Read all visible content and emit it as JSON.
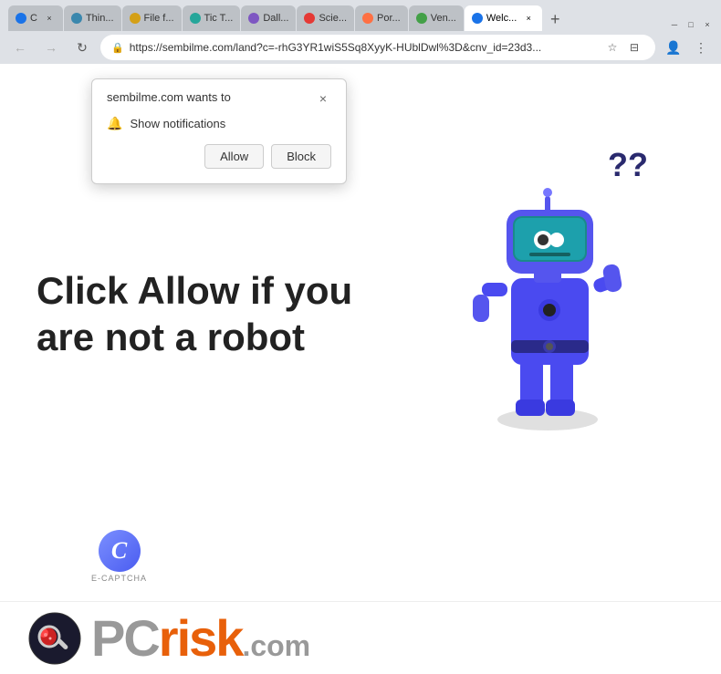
{
  "browser": {
    "tabs": [
      {
        "id": "tab1",
        "label": "C ×",
        "active": false,
        "favicon_color": "#1a73e8"
      },
      {
        "id": "tab2",
        "label": "Thin...",
        "active": false,
        "favicon_color": "#3a87ad"
      },
      {
        "id": "tab3",
        "label": "File f...",
        "active": false,
        "favicon_color": "#d4a017"
      },
      {
        "id": "tab4",
        "label": "Tic T...",
        "active": false,
        "favicon_color": "#26a69a"
      },
      {
        "id": "tab5",
        "label": "Dall...",
        "active": false,
        "favicon_color": "#7e57c2"
      },
      {
        "id": "tab6",
        "label": "Scie...",
        "active": false,
        "favicon_color": "#e53935"
      },
      {
        "id": "tab7",
        "label": "Por...",
        "active": false,
        "favicon_color": "#ff7043"
      },
      {
        "id": "tab8",
        "label": "Ven...",
        "active": false,
        "favicon_color": "#43a047"
      },
      {
        "id": "tab9",
        "label": "Welc...",
        "active": true,
        "favicon_color": "#1a73e8"
      },
      {
        "id": "tab-new",
        "label": "+",
        "active": false,
        "favicon_color": ""
      }
    ],
    "url": "https://sembilme.com/land?c=-rhG3YR1wiS5Sq8XyyK-HUblDwl%3D&cnv_id=23d3...",
    "nav": {
      "back_disabled": true,
      "forward_disabled": true
    }
  },
  "permission_popup": {
    "title": "sembilme.com wants to",
    "option": "Show notifications",
    "allow_label": "Allow",
    "block_label": "Block"
  },
  "webpage": {
    "main_text": "Click Allow if you are not a robot",
    "ecaptcha_label": "E-CAPTCHA"
  },
  "footer": {
    "brand": "PC",
    "risk": "risk",
    "com": ".com"
  },
  "icons": {
    "back": "←",
    "forward": "→",
    "refresh": "↻",
    "lock": "🔒",
    "star": "☆",
    "bookmark": "⊟",
    "profile": "👤",
    "menu": "⋮",
    "close": "×",
    "bell": "🔔"
  }
}
